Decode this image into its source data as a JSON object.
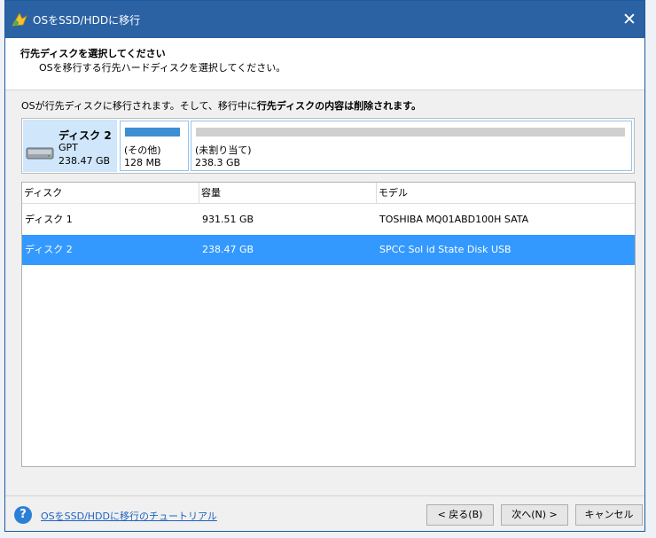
{
  "window": {
    "title": "OSをSSD/HDDに移行",
    "close_label": "✕"
  },
  "header": {
    "title": "行先ディスクを選択してください",
    "subtitle": "OSを移行する行先ハードディスクを選択してください。"
  },
  "notice": {
    "prefix": "OSが行先ディスクに移行されます。そして、移行中に",
    "bold": "行先ディスクの内容は削除されます。"
  },
  "selected_disk": {
    "name": "ディスク 2",
    "type": "GPT",
    "size": "238.47 GB",
    "partitions": [
      {
        "label": "(その他)",
        "size": "128 MB",
        "bar_color": "#3d8ed3"
      },
      {
        "label": "(未割り当て)",
        "size": "238.3 GB",
        "bar_color": "#cfcfcf"
      }
    ]
  },
  "table": {
    "columns": [
      "ディスク",
      "容量",
      "モデル"
    ],
    "rows": [
      {
        "disk": "ディスク 1",
        "capacity": "931.51 GB",
        "model": "TOSHIBA MQ01ABD100H SATA",
        "selected": false
      },
      {
        "disk": "ディスク 2",
        "capacity": "238.47 GB",
        "model": "SPCC Sol id State Disk USB",
        "selected": true
      }
    ]
  },
  "footer": {
    "help_icon": "?",
    "help_link": "OSをSSD/HDDに移行のチュートリアル",
    "back_label": "< 戻る(B)",
    "next_label": "次へ(N) >",
    "cancel_label": "キャンセル"
  },
  "colors": {
    "titlebar": "#2b62a4",
    "selection": "#3399ff",
    "disk_info_bg": "#cfe6fb",
    "link": "#1f63c2"
  }
}
